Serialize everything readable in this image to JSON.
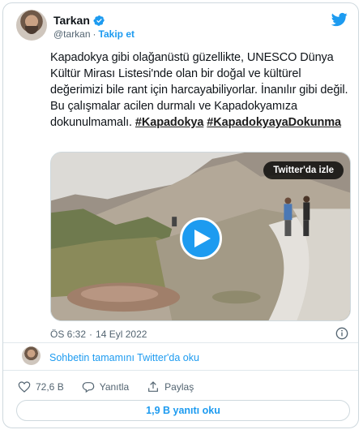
{
  "author": {
    "name": "Tarkan",
    "handle": "@tarkan",
    "separator": "·",
    "follow_label": "Takip et"
  },
  "tweet": {
    "text": "Kapadokya gibi olağanüstü güzellikte, UNESCO Dünya Kültür Mirası Listesi'nde olan bir doğal ve kültürel değerimizi bile rant için harcayabiliyorlar. İnanılır gibi değil. Bu çalışmalar acilen durmalı ve Kapadokyamıza dokunulmamalı.",
    "hashtags": [
      "#Kapadokya",
      "#KapadokyayaDokunma"
    ]
  },
  "video": {
    "watch_label": "Twitter'da izle"
  },
  "meta": {
    "time": "ÖS 6:32",
    "separator": "·",
    "date": "14 Eyl 2022"
  },
  "conversation": {
    "link_label": "Sohbetin tamamını Twitter'da oku"
  },
  "actions": {
    "likes": "72,6 B",
    "reply_label": "Yanıtla",
    "share_label": "Paylaş"
  },
  "replies_button": {
    "label": "1,9 B yanıtı oku"
  },
  "colors": {
    "accent": "#1d9bf0",
    "text": "#0f1419",
    "secondary": "#536471",
    "border": "#cfd9de"
  },
  "icons": [
    "verified-badge-icon",
    "twitter-bird-icon",
    "play-icon",
    "info-icon",
    "heart-icon",
    "reply-bubble-icon",
    "share-icon"
  ]
}
